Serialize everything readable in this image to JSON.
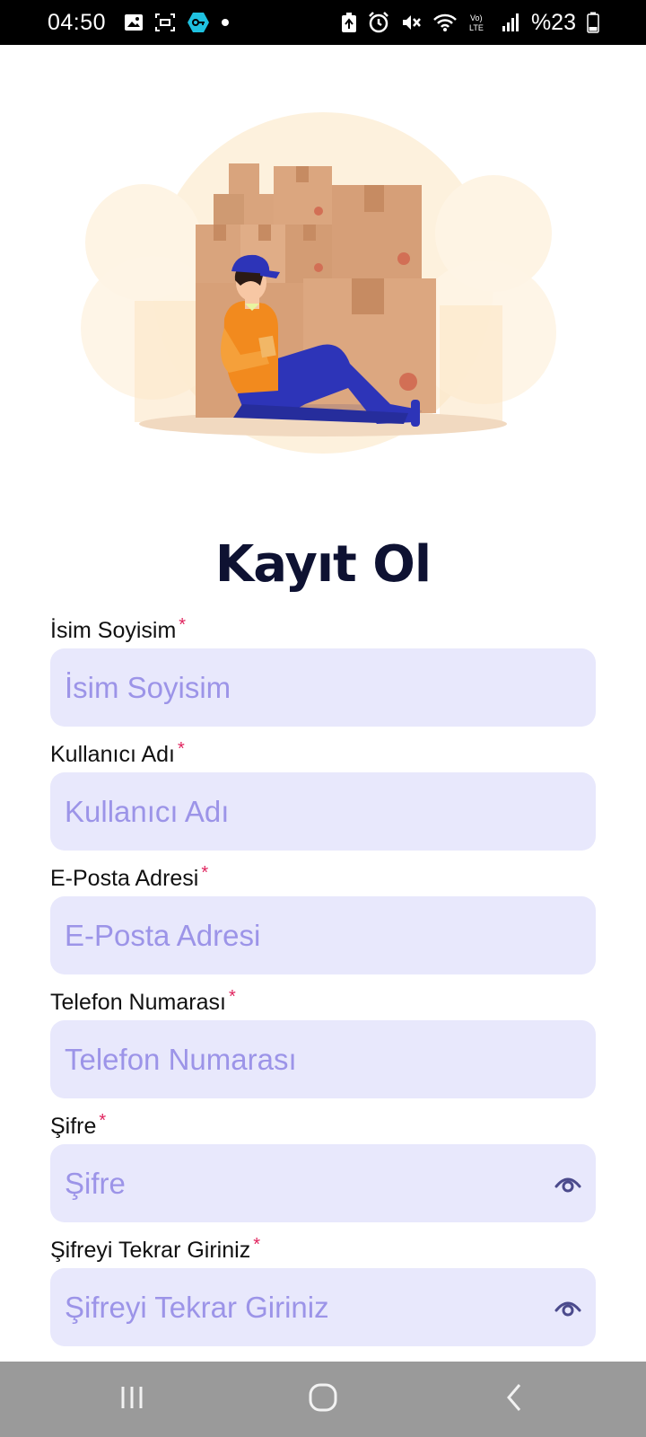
{
  "status_bar": {
    "time": "04:50",
    "battery": "%23",
    "left_icons": [
      "image-icon",
      "screenshot-icon",
      "vpn-key-icon",
      "dot-icon"
    ],
    "right_icons": [
      "battery-saver-icon",
      "alarm-icon",
      "mute-icon",
      "wifi-icon",
      "volte-icon",
      "signal-icon",
      "battery-icon"
    ]
  },
  "page": {
    "title": "Kayıt Ol"
  },
  "form": {
    "fields": [
      {
        "label": "İsim Soyisim",
        "required": "*",
        "placeholder": "İsim Soyisim",
        "value": ""
      },
      {
        "label": "Kullanıcı Adı",
        "required": "*",
        "placeholder": "Kullanıcı Adı",
        "value": ""
      },
      {
        "label": "E-Posta Adresi",
        "required": "*",
        "placeholder": "E-Posta Adresi",
        "value": ""
      },
      {
        "label": "Telefon Numarası",
        "required": "*",
        "placeholder": "Telefon Numarası",
        "value": ""
      },
      {
        "label": "Şifre",
        "required": "*",
        "placeholder": "Şifre",
        "value": "",
        "icon": "eye-icon"
      },
      {
        "label": "Şifreyi Tekrar Giriniz",
        "required": "*",
        "placeholder": "Şifreyi Tekrar Giriniz",
        "value": "",
        "icon": "eye-icon"
      }
    ]
  },
  "nav_bar": {
    "buttons": [
      "recents-icon",
      "home-icon",
      "back-icon"
    ]
  },
  "colors": {
    "input_bg": "#e8e8fc",
    "placeholder": "#9c94e8",
    "title": "#0e1232",
    "required": "#e0245e",
    "eye_icon": "#4b4a8c"
  }
}
